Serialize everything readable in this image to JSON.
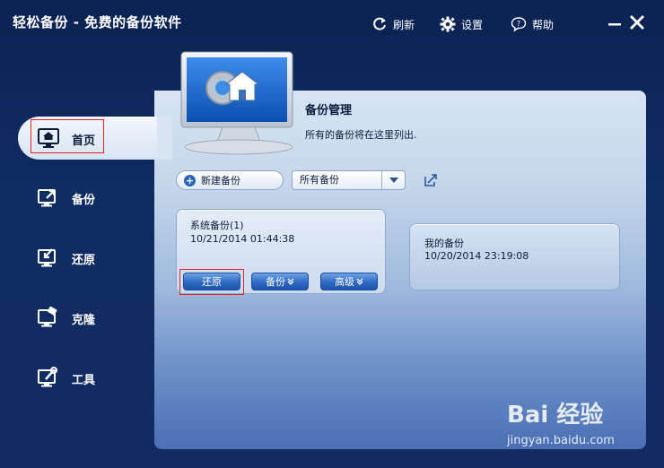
{
  "window": {
    "title": "轻松备份 - 免费的备份软件",
    "actions": {
      "refresh": "刷新",
      "settings": "设置",
      "help": "帮助"
    }
  },
  "sidebar": {
    "items": [
      {
        "id": "home",
        "label": "首页",
        "icon": "monitor-home-icon",
        "active": true
      },
      {
        "id": "backup",
        "label": "备份",
        "icon": "backup-export-icon",
        "active": false
      },
      {
        "id": "restore",
        "label": "还原",
        "icon": "restore-icon",
        "active": false
      },
      {
        "id": "clone",
        "label": "克隆",
        "icon": "clone-icon",
        "active": false
      },
      {
        "id": "tools",
        "label": "工具",
        "icon": "tools-icon",
        "active": false
      }
    ]
  },
  "main": {
    "title": "备份管理",
    "subtitle": "所有的备份将在这里列出.",
    "toolbar": {
      "new_backup": "新建备份",
      "filter_selected": "所有备份"
    },
    "backups": [
      {
        "name": "系统备份(1)",
        "time": "10/21/2014 01:44:38",
        "buttons": {
          "restore": "还原",
          "backup": "备份",
          "advanced": "高级"
        }
      },
      {
        "name": "我的备份",
        "time": "10/20/2014 23:19:08"
      }
    ]
  },
  "watermark": {
    "brand": "Bai 经验",
    "sub": "jingyan.baidu.com"
  },
  "colors": {
    "window_bg": "#0f2c63",
    "accent_button": "#2d68c4",
    "highlight_box": "#e0252a"
  }
}
